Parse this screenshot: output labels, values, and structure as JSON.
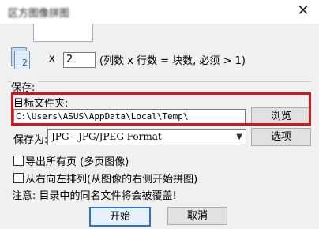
{
  "window": {
    "title": "(blurred title)",
    "close_glyph": "✕"
  },
  "tiles": {
    "icon": "tile-stack-icon",
    "number": "2"
  },
  "grid": {
    "x_label": "x",
    "rows_value": "2",
    "hint": "(列数 x 行数 = 块数, 必须 > 1)"
  },
  "save": {
    "group_label": "保存:",
    "folder_label": "目标文件夹:",
    "folder_path": "C:\\Users\\ASUS\\AppData\\Local\\Temp\\",
    "browse_label": "浏览",
    "save_as_label": "保存为:",
    "format_value": "JPG - JPG/JPEG Format",
    "options_label": "选项"
  },
  "checkboxes": {
    "export_all": "导出所有页 (多页图像)",
    "right_to_left": "从右向左排列(从图像的右侧开始拼图)"
  },
  "notice": "注意: 目录中的同名文件将会被覆盖!",
  "buttons": {
    "start": "开始",
    "cancel": "取消"
  },
  "colors": {
    "highlight_box": "#d0181e",
    "default_button_border": "#2a72d6"
  }
}
